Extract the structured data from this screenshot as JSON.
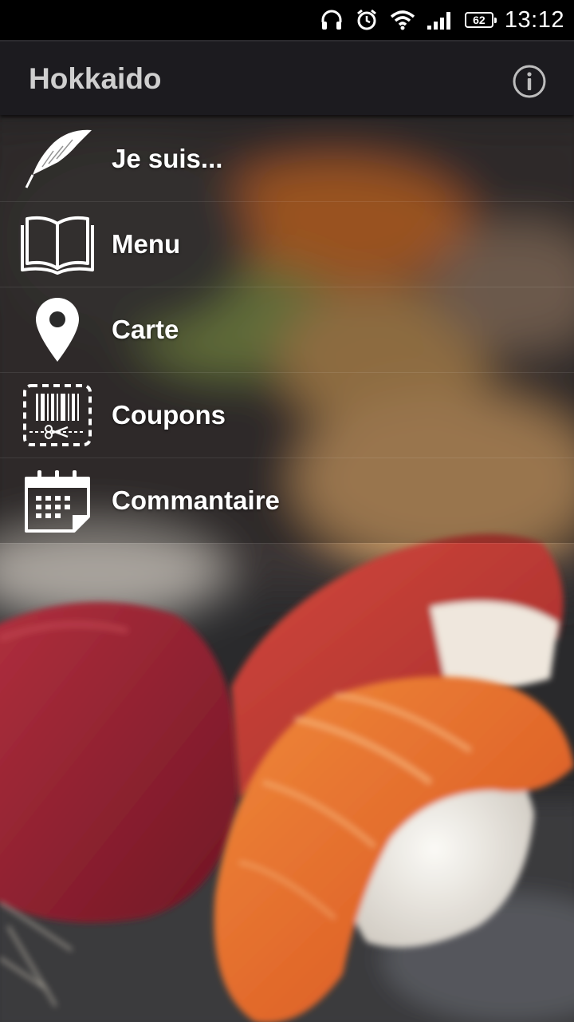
{
  "status_bar": {
    "battery": "62",
    "time": "13:12",
    "icons": [
      "headset-icon",
      "alarm-icon",
      "wifi-icon",
      "signal-icon",
      "battery-icon"
    ]
  },
  "app_bar": {
    "title": "Hokkaido",
    "info_icon": "info-icon"
  },
  "nav": {
    "items": [
      {
        "label": "Je suis...",
        "icon": "feather-icon"
      },
      {
        "label": "Menu",
        "icon": "open-book-icon"
      },
      {
        "label": "Carte",
        "icon": "map-pin-icon"
      },
      {
        "label": "Coupons",
        "icon": "barcode-coupon-icon"
      },
      {
        "label": "Commantaire",
        "icon": "calendar-icon"
      }
    ]
  },
  "colors": {
    "app_bar_bg": "#1c1b1f",
    "status_bar_bg": "#000000",
    "title_color": "#cfcfcf",
    "label_color": "#ffffff"
  }
}
